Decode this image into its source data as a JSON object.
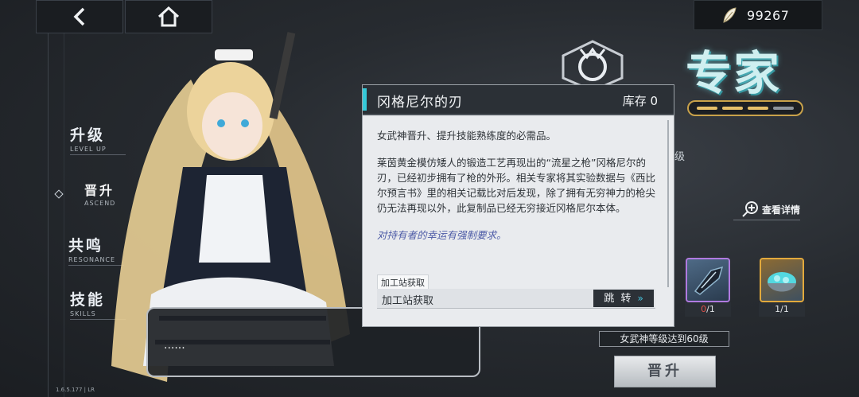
{
  "nav": {
    "back_icon": "chevron-left-icon",
    "home_icon": "home-icon"
  },
  "currency": {
    "icon": "feather-icon",
    "value": "99267"
  },
  "side_menu": [
    {
      "zh": "升级",
      "en": "LEVEL UP"
    },
    {
      "zh": "晋升",
      "en": "ASCEND"
    },
    {
      "zh": "共鸣",
      "en": "RESONANCE"
    },
    {
      "zh": "技能",
      "en": "SKILLS"
    }
  ],
  "difficulty": {
    "label": "专家",
    "level_filled": 3,
    "level_total": 4
  },
  "partial_text": "级",
  "view_detail": "查看详情",
  "materials": [
    {
      "count_owned": "0",
      "count_need": "/1",
      "rarity_color": "#b07ae0"
    },
    {
      "count": "1/1",
      "rarity_color": "#e2a93c"
    }
  ],
  "requirement": "女武神等级达到60级",
  "ascend_button": "晋升",
  "dialogue": {
    "text": "......"
  },
  "version": "1.6.5.177 | LR",
  "popup": {
    "title": "冈格尼尔的刃",
    "stock": "库存 0",
    "paragraphs": [
      "女武神晋升、提升技能熟练度的必需品。",
      "莱茵黄金模仿矮人的锻造工艺再现出的“流星之枪”冈格尼尔的刃，已经初步拥有了枪的外形。相关专家将其实验数据与《西比尔预言书》里的相关记载比对后发现，除了拥有无穷神力的枪尖仍无法再现以外，此复制品已经无穷接近冈格尼尔本体。"
    ],
    "flavor": "对持有者的幸运有强制要求。",
    "source_label": "加工站获取",
    "source_row": "加工站获取",
    "jump_button": "跳 转"
  }
}
